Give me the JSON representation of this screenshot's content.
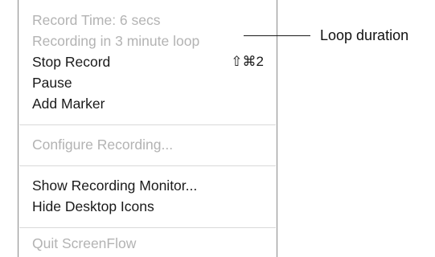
{
  "menu": {
    "items": [
      {
        "label": "Record Time: 6 secs",
        "enabled": false
      },
      {
        "label": "Recording in 3 minute loop",
        "enabled": false
      },
      {
        "label": "Stop Record",
        "shortcut": "⇧⌘2",
        "enabled": true
      },
      {
        "label": "Pause",
        "enabled": true
      },
      {
        "label": "Add Marker",
        "enabled": true
      },
      {
        "label": "Configure Recording...",
        "enabled": false
      },
      {
        "label": "Show Recording Monitor...",
        "enabled": true
      },
      {
        "label": "Hide Desktop Icons",
        "enabled": true
      },
      {
        "label": "Quit ScreenFlow",
        "enabled": false
      }
    ]
  },
  "callout": {
    "label": "Loop duration"
  },
  "colors": {
    "enabled_text": "#1a1a1a",
    "disabled_text": "#b3b3b3",
    "separator": "#d9d9d9"
  }
}
